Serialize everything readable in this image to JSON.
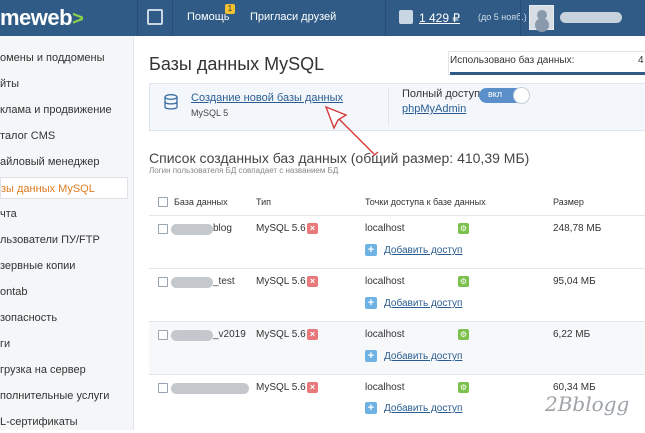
{
  "topbar": {
    "logo_text": "meweb",
    "logo_arrow": ">",
    "help_label": "Помощь",
    "help_badge": "1",
    "invite_label": "Пригласи друзей",
    "balance": "1 429 ₽",
    "balance_note": "(до 5 нояб.)",
    "colors": {
      "bg": "#2f5b86",
      "accent": "#8bd14a"
    }
  },
  "sidebar": {
    "items": [
      {
        "label": "омены и поддомены"
      },
      {
        "label": "йты"
      },
      {
        "label": "клама и продвижение"
      },
      {
        "label": "талог CMS"
      },
      {
        "label": "айловый менеджер"
      },
      {
        "label": "зы данных MySQL",
        "active": true
      },
      {
        "label": "чта"
      },
      {
        "label": "льзователи ПУ/FTP"
      },
      {
        "label": "зервные копии"
      },
      {
        "label": "ontab"
      },
      {
        "label": "зопасность"
      },
      {
        "label": "ги"
      },
      {
        "label": "грузка на сервер"
      },
      {
        "label": "полнительные услуги"
      },
      {
        "label": "L-сертификаты"
      }
    ]
  },
  "page": {
    "title": "Базы данных MySQL",
    "usage_label": "Использовано баз данных:",
    "usage_value": "4"
  },
  "create_panel": {
    "create_link": "Создание новой базы данных",
    "mysql_version": "MySQL 5",
    "full_access_label": "Полный доступ",
    "pma_link": "phpMyAdmin",
    "toggle_label": "вкл",
    "toggle_on": true
  },
  "list": {
    "title": "Список созданных баз данных (общий размер: 410,39 МБ)",
    "subtitle": "Логин пользователя БД совпадает с названием БД",
    "headers": {
      "name": "База данных",
      "type": "Тип",
      "access": "Точки доступа к базе данных",
      "size": "Размер"
    },
    "rows": [
      {
        "name_suffix": "blog",
        "type": "MySQL 5.6",
        "host": "localhost",
        "add_access": "Добавить доступ",
        "size": "248,78 МБ"
      },
      {
        "name_suffix": "_test",
        "type": "MySQL 5.6",
        "host": "localhost",
        "add_access": "Добавить доступ",
        "size": "95,04 МБ"
      },
      {
        "name_suffix": "_v2019",
        "type": "MySQL 5.6",
        "host": "localhost",
        "add_access": "Добавить доступ",
        "size": "6,22 МБ"
      },
      {
        "name_suffix": "",
        "type": "MySQL 5.6",
        "host": "localhost",
        "add_access": "Добавить доступ",
        "size": "60,34 МБ"
      }
    ]
  },
  "watermark": "2Bblogg"
}
